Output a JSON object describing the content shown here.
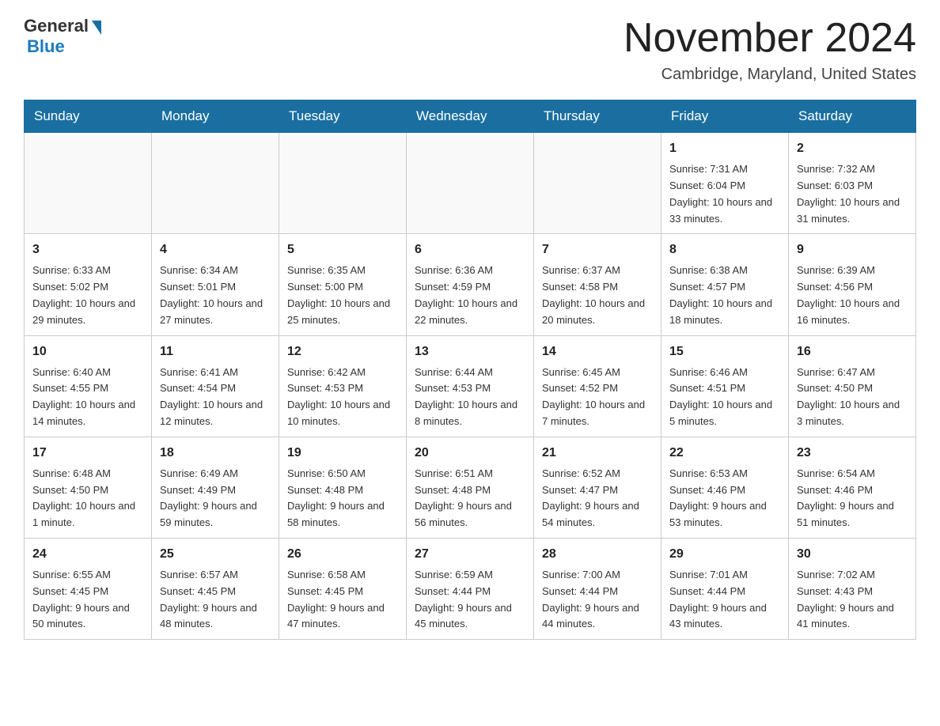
{
  "logo": {
    "general": "General",
    "blue": "Blue"
  },
  "title": {
    "month": "November 2024",
    "location": "Cambridge, Maryland, United States"
  },
  "weekdays": [
    "Sunday",
    "Monday",
    "Tuesday",
    "Wednesday",
    "Thursday",
    "Friday",
    "Saturday"
  ],
  "weeks": [
    [
      {
        "day": "",
        "info": ""
      },
      {
        "day": "",
        "info": ""
      },
      {
        "day": "",
        "info": ""
      },
      {
        "day": "",
        "info": ""
      },
      {
        "day": "",
        "info": ""
      },
      {
        "day": "1",
        "info": "Sunrise: 7:31 AM\nSunset: 6:04 PM\nDaylight: 10 hours and 33 minutes."
      },
      {
        "day": "2",
        "info": "Sunrise: 7:32 AM\nSunset: 6:03 PM\nDaylight: 10 hours and 31 minutes."
      }
    ],
    [
      {
        "day": "3",
        "info": "Sunrise: 6:33 AM\nSunset: 5:02 PM\nDaylight: 10 hours and 29 minutes."
      },
      {
        "day": "4",
        "info": "Sunrise: 6:34 AM\nSunset: 5:01 PM\nDaylight: 10 hours and 27 minutes."
      },
      {
        "day": "5",
        "info": "Sunrise: 6:35 AM\nSunset: 5:00 PM\nDaylight: 10 hours and 25 minutes."
      },
      {
        "day": "6",
        "info": "Sunrise: 6:36 AM\nSunset: 4:59 PM\nDaylight: 10 hours and 22 minutes."
      },
      {
        "day": "7",
        "info": "Sunrise: 6:37 AM\nSunset: 4:58 PM\nDaylight: 10 hours and 20 minutes."
      },
      {
        "day": "8",
        "info": "Sunrise: 6:38 AM\nSunset: 4:57 PM\nDaylight: 10 hours and 18 minutes."
      },
      {
        "day": "9",
        "info": "Sunrise: 6:39 AM\nSunset: 4:56 PM\nDaylight: 10 hours and 16 minutes."
      }
    ],
    [
      {
        "day": "10",
        "info": "Sunrise: 6:40 AM\nSunset: 4:55 PM\nDaylight: 10 hours and 14 minutes."
      },
      {
        "day": "11",
        "info": "Sunrise: 6:41 AM\nSunset: 4:54 PM\nDaylight: 10 hours and 12 minutes."
      },
      {
        "day": "12",
        "info": "Sunrise: 6:42 AM\nSunset: 4:53 PM\nDaylight: 10 hours and 10 minutes."
      },
      {
        "day": "13",
        "info": "Sunrise: 6:44 AM\nSunset: 4:53 PM\nDaylight: 10 hours and 8 minutes."
      },
      {
        "day": "14",
        "info": "Sunrise: 6:45 AM\nSunset: 4:52 PM\nDaylight: 10 hours and 7 minutes."
      },
      {
        "day": "15",
        "info": "Sunrise: 6:46 AM\nSunset: 4:51 PM\nDaylight: 10 hours and 5 minutes."
      },
      {
        "day": "16",
        "info": "Sunrise: 6:47 AM\nSunset: 4:50 PM\nDaylight: 10 hours and 3 minutes."
      }
    ],
    [
      {
        "day": "17",
        "info": "Sunrise: 6:48 AM\nSunset: 4:50 PM\nDaylight: 10 hours and 1 minute."
      },
      {
        "day": "18",
        "info": "Sunrise: 6:49 AM\nSunset: 4:49 PM\nDaylight: 9 hours and 59 minutes."
      },
      {
        "day": "19",
        "info": "Sunrise: 6:50 AM\nSunset: 4:48 PM\nDaylight: 9 hours and 58 minutes."
      },
      {
        "day": "20",
        "info": "Sunrise: 6:51 AM\nSunset: 4:48 PM\nDaylight: 9 hours and 56 minutes."
      },
      {
        "day": "21",
        "info": "Sunrise: 6:52 AM\nSunset: 4:47 PM\nDaylight: 9 hours and 54 minutes."
      },
      {
        "day": "22",
        "info": "Sunrise: 6:53 AM\nSunset: 4:46 PM\nDaylight: 9 hours and 53 minutes."
      },
      {
        "day": "23",
        "info": "Sunrise: 6:54 AM\nSunset: 4:46 PM\nDaylight: 9 hours and 51 minutes."
      }
    ],
    [
      {
        "day": "24",
        "info": "Sunrise: 6:55 AM\nSunset: 4:45 PM\nDaylight: 9 hours and 50 minutes."
      },
      {
        "day": "25",
        "info": "Sunrise: 6:57 AM\nSunset: 4:45 PM\nDaylight: 9 hours and 48 minutes."
      },
      {
        "day": "26",
        "info": "Sunrise: 6:58 AM\nSunset: 4:45 PM\nDaylight: 9 hours and 47 minutes."
      },
      {
        "day": "27",
        "info": "Sunrise: 6:59 AM\nSunset: 4:44 PM\nDaylight: 9 hours and 45 minutes."
      },
      {
        "day": "28",
        "info": "Sunrise: 7:00 AM\nSunset: 4:44 PM\nDaylight: 9 hours and 44 minutes."
      },
      {
        "day": "29",
        "info": "Sunrise: 7:01 AM\nSunset: 4:44 PM\nDaylight: 9 hours and 43 minutes."
      },
      {
        "day": "30",
        "info": "Sunrise: 7:02 AM\nSunset: 4:43 PM\nDaylight: 9 hours and 41 minutes."
      }
    ]
  ]
}
